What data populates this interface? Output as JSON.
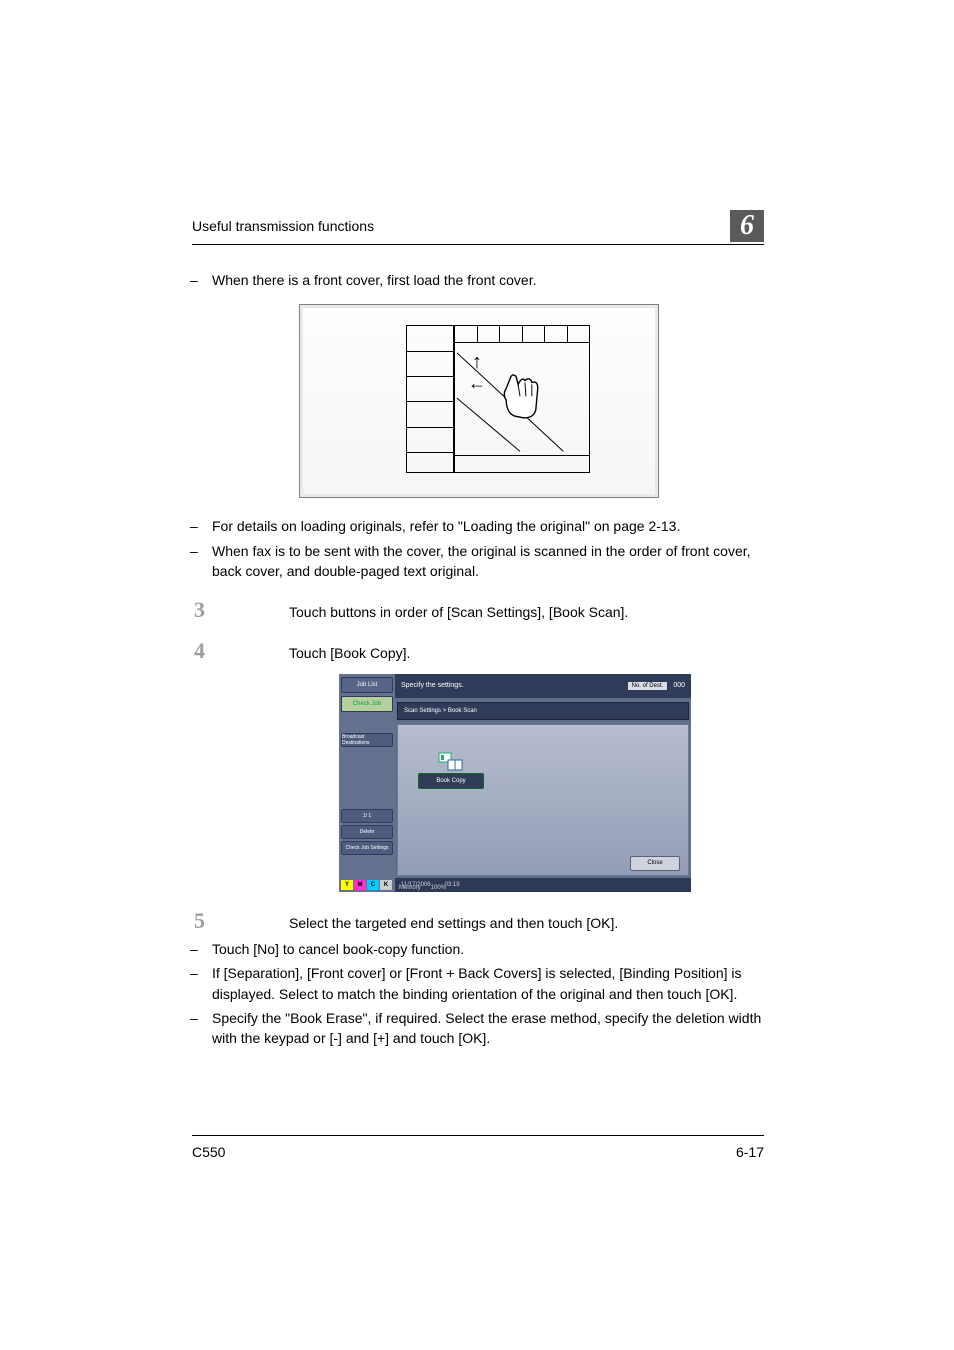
{
  "header": {
    "running_title": "Useful transmission functions",
    "chapter_number": "6"
  },
  "bullets_top": [
    "When there is a front cover, first load the front cover."
  ],
  "bullets_mid": [
    "For details on loading originals, refer to \"Loading the original\" on page 2-13.",
    "When fax is to be sent with the cover, the original is scanned in the order of front cover, back cover, and double-paged text original."
  ],
  "steps": {
    "s3": {
      "num": "3",
      "text": "Touch buttons in order of [Scan Settings], [Book Scan]."
    },
    "s4": {
      "num": "4",
      "text": "Touch [Book Copy]."
    },
    "s5": {
      "num": "5",
      "text": "Select the targeted end settings and then touch [OK]."
    }
  },
  "bullets_bottom": [
    "Touch [No] to cancel book-copy function.",
    "If [Separation], [Front cover] or [Front + Back Covers] is selected, [Binding Position] is displayed. Select to match the binding orientation of the original and then touch [OK].",
    "Specify the \"Book Erase\", if required. Select the erase method, specify the deletion width with the keypad or [-] and [+] and touch [OK]."
  ],
  "screenshot": {
    "topline": "Specify the settings.",
    "dest_label": "No. of Dest.",
    "dest_count": "000",
    "left_tabs": {
      "job_list": "Job List",
      "check_job": "Check Job",
      "broadcast": "Broadcast Destinations",
      "pager": "1/  1",
      "delete": "Delete",
      "check_settings": "Check Job Settings"
    },
    "toner": {
      "y": "Y",
      "m": "M",
      "c": "C",
      "k": "K"
    },
    "breadcrumb": "Scan Settings > Book Scan",
    "button_label": "Book Copy",
    "close": "Close",
    "status": {
      "date": "11/17/2006",
      "time": "03:19",
      "memory_label": "Memory",
      "memory_val": "100%"
    }
  },
  "footer": {
    "model": "C550",
    "page": "6-17"
  }
}
